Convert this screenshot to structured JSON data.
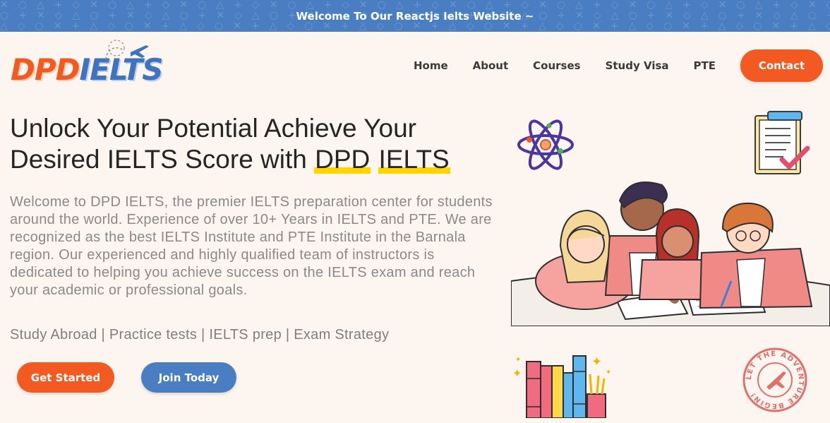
{
  "topbar": {
    "message": "Welcome To Our Reactjs Ielts Website ~"
  },
  "logo": {
    "part1": "DPD",
    "part2": "IELTS"
  },
  "nav": {
    "items": [
      "Home",
      "About",
      "Courses",
      "Study Visa",
      "PTE"
    ],
    "contact": "Contact"
  },
  "hero": {
    "title_line1": "Unlock Your Potential Achieve Your",
    "title_line2_pre": "Desired IELTS Score with ",
    "title_hl1": "DPD",
    "title_hl2": "IELTS",
    "description": "Welcome to DPD IELTS, the premier IELTS preparation center for students around the world. Experience of over 10+ Years in IELTS and PTE. We are recognized as the best IELTS Institute and PTE Institute in the Barnala region. Our experienced and highly qualified team of instructors is dedicated to helping you achieve success on the IELTS exam and reach your academic or professional goals.",
    "tagline": "Study Abroad | Practice tests | IELTS prep | Exam Strategy",
    "get_started": "Get Started",
    "join_today": "Join Today"
  },
  "stamp": {
    "text": "LET THE ADVENTURE BEGIN!"
  },
  "colors": {
    "accent": "#f25a22",
    "brand_blue": "#4a7ec2",
    "highlight": "#ffd400",
    "background": "#fdf5ef"
  }
}
